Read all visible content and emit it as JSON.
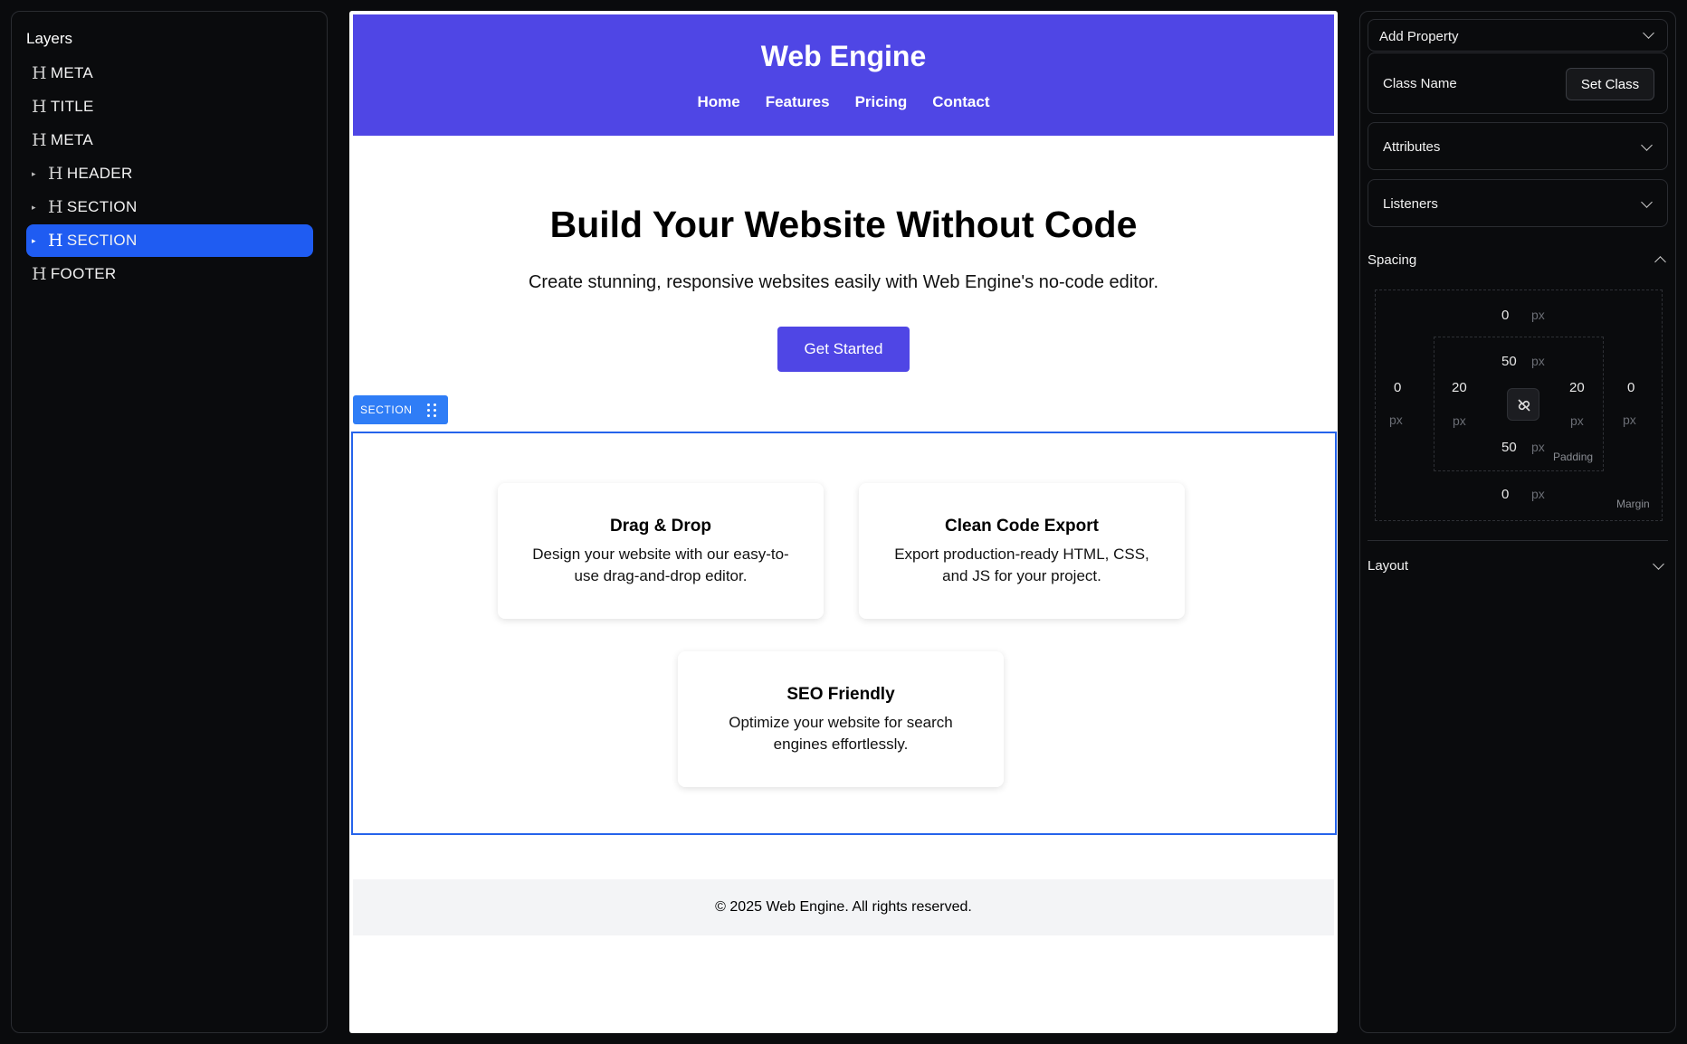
{
  "layers": {
    "title": "Layers",
    "items": [
      {
        "label": "META"
      },
      {
        "label": "TITLE"
      },
      {
        "label": "META"
      },
      {
        "label": "HEADER"
      },
      {
        "label": "SECTION"
      },
      {
        "label": "SECTION"
      },
      {
        "label": "FOOTER"
      }
    ]
  },
  "site": {
    "title": "Web Engine",
    "nav": [
      "Home",
      "Features",
      "Pricing",
      "Contact"
    ],
    "hero_title": "Build Your Website Without Code",
    "hero_subtitle": "Create stunning, responsive websites easily with Web Engine's no-code editor.",
    "cta": "Get Started",
    "section_tag": "SECTION",
    "features": [
      {
        "title": "Drag & Drop",
        "text": "Design your website with our easy-to-use drag-and-drop editor."
      },
      {
        "title": "Clean Code Export",
        "text": "Export production-ready HTML, CSS, and JS for your project."
      },
      {
        "title": "SEO Friendly",
        "text": "Optimize your website for search engines effortlessly."
      }
    ],
    "footer": "© 2025 Web Engine. All rights reserved."
  },
  "props": {
    "add_property": "Add Property",
    "class_name": "Class Name",
    "set_class": "Set Class",
    "attributes": "Attributes",
    "listeners": "Listeners",
    "spacing": "Spacing",
    "layout": "Layout",
    "unit": "px",
    "margin": {
      "top": "0",
      "right": "0",
      "bottom": "0",
      "left": "0",
      "label": "Margin"
    },
    "padding": {
      "top": "50",
      "right": "20",
      "bottom": "50",
      "left": "20",
      "label": "Padding"
    }
  },
  "colors": {
    "accent": "#1f5cf2",
    "brand": "#4f46e5",
    "selection": "#2563eb"
  }
}
